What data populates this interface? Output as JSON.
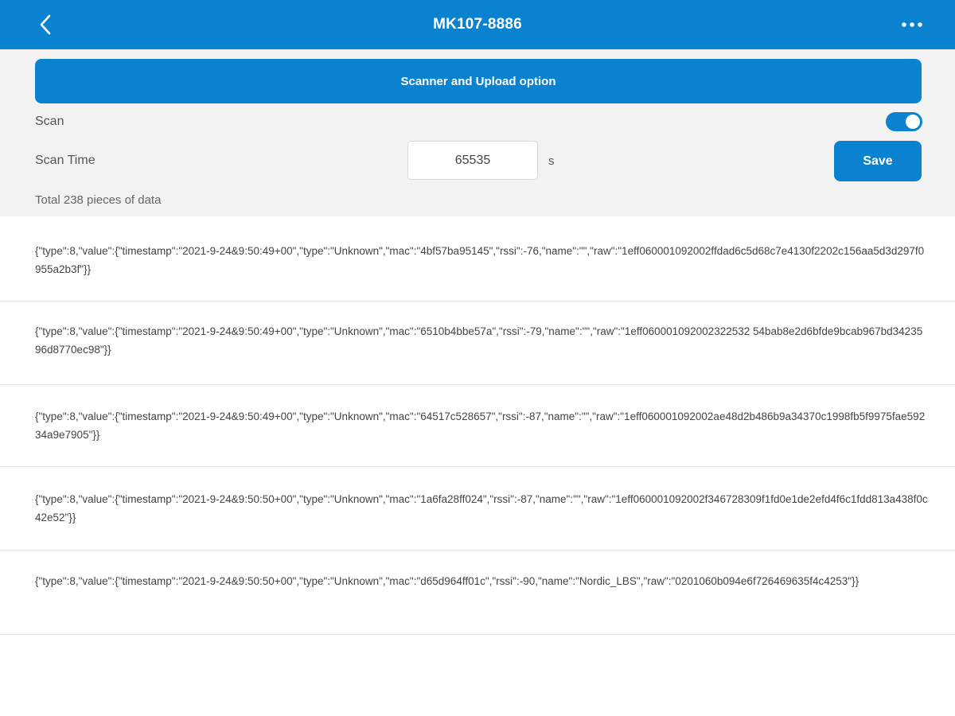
{
  "app_bar": {
    "title": "MK107-8886",
    "back_icon": "chevron-left-icon",
    "more_icon": "more-horizontal-icon"
  },
  "settings": {
    "scanner_button_label": "Scanner and Upload option",
    "scan_label": "Scan",
    "scan_enabled": true,
    "scan_time_label": "Scan Time",
    "scan_time_value": "65535",
    "scan_time_unit": "s",
    "save_label": "Save",
    "total_text": "Total 238 pieces of data"
  },
  "records": [
    "{\"type\":8,\"value\":{\"timestamp\":\"2021-9-24&9:50:49+00\",\"type\":\"Unknown\",\"mac\":\"4bf57ba95145\",\"rssi\":-76,\"name\":\"\",\"raw\":\"1eff060001092002ffdad6c5d68c7e4130f2202c156aa5d3d297f0955a2b3f\"}}",
    "{\"type\":8,\"value\":{\"timestamp\":\"2021-9-24&9:50:49+00\",\"type\":\"Unknown\",\"mac\":\"6510b4bbe57a\",\"rssi\":-79,\"name\":\"\",\"raw\":\"1eff060001092002322532 54bab8e2d6bfde9bcab967bd3423596d8770ec98\"}}",
    "{\"type\":8,\"value\":{\"timestamp\":\"2021-9-24&9:50:49+00\",\"type\":\"Unknown\",\"mac\":\"64517c528657\",\"rssi\":-87,\"name\":\"\",\"raw\":\"1eff060001092002ae48d2b486b9a34370c1998fb5f9975fae59234a9e7905\"}}",
    "{\"type\":8,\"value\":{\"timestamp\":\"2021-9-24&9:50:50+00\",\"type\":\"Unknown\",\"mac\":\"1a6fa28ff024\",\"rssi\":-87,\"name\":\"\",\"raw\":\"1eff060001092002f346728309f1fd0e1de2efd4f6c1fdd813a438f0c42e52\"}}",
    "{\"type\":8,\"value\":{\"timestamp\":\"2021-9-24&9:50:50+00\",\"type\":\"Unknown\",\"mac\":\"d65d964ff01c\",\"rssi\":-90,\"name\":\"Nordic_LBS\",\"raw\":\"0201060b094e6f726469635f4c4253\"}}"
  ],
  "colors": {
    "primary": "#0b82cf",
    "panel_bg": "#f2f2f2",
    "divider": "#e6e6e6"
  }
}
